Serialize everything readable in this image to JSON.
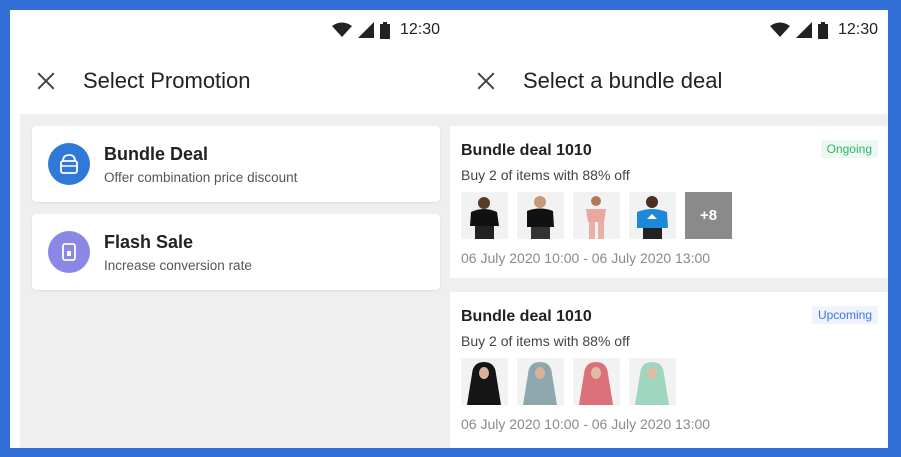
{
  "status_bar": {
    "time": "12:30"
  },
  "left_screen": {
    "title": "Select Promotion",
    "promotions": [
      {
        "title": "Bundle Deal",
        "subtitle": "Offer combination price discount",
        "icon": "bag-icon",
        "color": "#2f7ad8"
      },
      {
        "title": "Flash Sale",
        "subtitle": "Increase conversion rate",
        "icon": "flash-sale-icon",
        "color": "#8b87e6"
      }
    ]
  },
  "right_screen": {
    "title": "Select a bundle deal",
    "deals": [
      {
        "title": "Bundle deal 1010",
        "status": "Ongoing",
        "description": "Buy 2 of items with 88% off",
        "more_count": "+8",
        "date_range": "06 July 2020 10:00 - 06 July 2020 13:00",
        "thumbnails": [
          "black-tshirt-model",
          "black-tshirt-model",
          "pink-outfit-model",
          "blue-adidas-tshirt-model",
          "more-items"
        ]
      },
      {
        "title": "Bundle deal 1010",
        "status": "Upcoming",
        "description": "Buy 2 of items with 88% off",
        "date_range": "06 July 2020 10:00 - 06 July 2020 13:00",
        "thumbnails": [
          "black-hijab-model",
          "grey-hijab-model",
          "pink-hijab-model",
          "mint-hijab-model"
        ]
      }
    ]
  },
  "colors": {
    "frame": "#2f6fd6",
    "ongoing": "#2fb56a",
    "upcoming": "#3b78e7"
  }
}
